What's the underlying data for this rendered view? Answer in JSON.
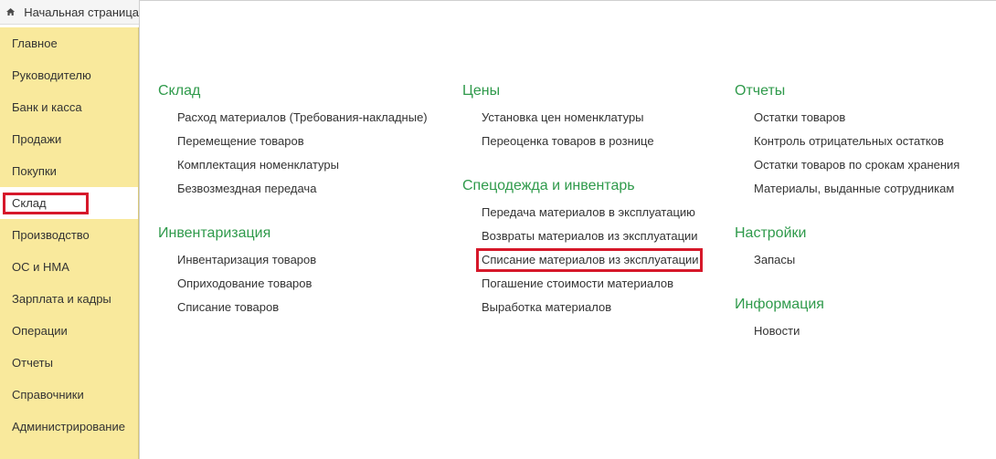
{
  "tab": {
    "label": "Начальная страница"
  },
  "sidebar": {
    "items": [
      {
        "label": "Главное"
      },
      {
        "label": "Руководителю"
      },
      {
        "label": "Банк и касса"
      },
      {
        "label": "Продажи"
      },
      {
        "label": "Покупки"
      },
      {
        "label": "Склад",
        "active": true
      },
      {
        "label": "Производство"
      },
      {
        "label": "ОС и НМА"
      },
      {
        "label": "Зарплата и кадры"
      },
      {
        "label": "Операции"
      },
      {
        "label": "Отчеты"
      },
      {
        "label": "Справочники"
      },
      {
        "label": "Администрирование"
      }
    ]
  },
  "col1": {
    "sklad": {
      "title": "Склад",
      "links": [
        "Расход материалов (Требования-накладные)",
        "Перемещение товаров",
        "Комплектация номенклатуры",
        "Безвозмездная передача"
      ]
    },
    "inventory": {
      "title": "Инвентаризация",
      "links": [
        "Инвентаризация товаров",
        "Оприходование товаров",
        "Списание товаров"
      ]
    }
  },
  "col2": {
    "prices": {
      "title": "Цены",
      "links": [
        "Установка цен номенклатуры",
        "Переоценка товаров в рознице"
      ]
    },
    "workwear": {
      "title": "Спецодежда и инвентарь",
      "links": [
        "Передача материалов в эксплуатацию",
        "Возвраты материалов из эксплуатации",
        "Списание материалов из эксплуатации",
        "Погашение стоимости материалов",
        "Выработка материалов"
      ]
    }
  },
  "col3": {
    "reports": {
      "title": "Отчеты",
      "links": [
        "Остатки товаров",
        "Контроль отрицательных остатков",
        "Остатки товаров по срокам хранения",
        "Материалы, выданные сотрудникам"
      ]
    },
    "settings": {
      "title": "Настройки",
      "links": [
        "Запасы"
      ]
    },
    "info": {
      "title": "Информация",
      "links": [
        "Новости"
      ]
    }
  },
  "colors": {
    "sidebar_bg": "#f9e99c",
    "section_title": "#2f9a4b",
    "highlight": "#d6182a"
  }
}
